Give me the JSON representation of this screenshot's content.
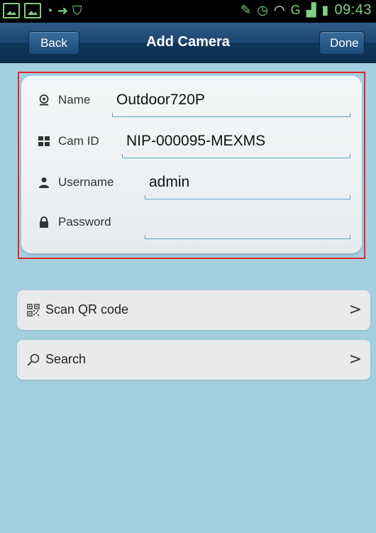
{
  "statusbar": {
    "time": "09:43",
    "network": "G"
  },
  "nav": {
    "back_label": "Back",
    "title": "Add Camera",
    "done_label": "Done"
  },
  "form": {
    "name": {
      "label": "Name",
      "value": "Outdoor720P",
      "icon": "webcam-icon"
    },
    "cam_id": {
      "label": "Cam ID",
      "value": "NIP-000095-MEXMS",
      "icon": "grid-icon"
    },
    "username": {
      "label": "Username",
      "value": "admin",
      "icon": "user-icon"
    },
    "password": {
      "label": "Password",
      "value": "",
      "icon": "lock-icon"
    }
  },
  "actions": {
    "scan_label": "Scan QR code",
    "search_label": "Search"
  },
  "colors": {
    "background": "#a3cfdf",
    "navbar": "#1c4670",
    "highlight": "#e3262b",
    "underline": "#5aa7c9"
  }
}
